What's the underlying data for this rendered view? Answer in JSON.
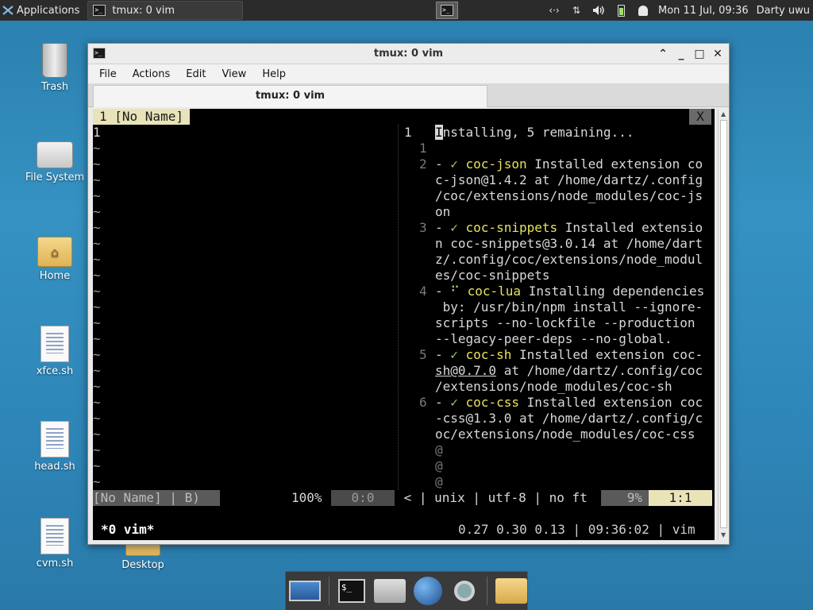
{
  "top_panel": {
    "applications_label": "Applications",
    "task_title": "tmux: 0 vim",
    "clock": "Mon 11 Jul, 09:36",
    "user": "Darty uwu",
    "icons": [
      "network-icon",
      "transfer-icon",
      "volume-icon",
      "battery-icon",
      "notification-bell-icon"
    ]
  },
  "desktop_icons": [
    {
      "label": "Trash",
      "icon": "trash-icon"
    },
    {
      "label": "File System",
      "icon": "drive-icon"
    },
    {
      "label": "Home",
      "icon": "home-folder-icon"
    },
    {
      "label": "xfce.sh",
      "icon": "script-file-icon"
    },
    {
      "label": "head.sh",
      "icon": "script-file-icon"
    },
    {
      "label": "cvm.sh",
      "icon": "script-file-icon"
    },
    {
      "label": "Desktop",
      "icon": "folder-icon"
    }
  ],
  "window": {
    "title": "tmux: 0 vim",
    "menu": [
      "File",
      "Actions",
      "Edit",
      "View",
      "Help"
    ],
    "tab_label": "tmux: 0 vim"
  },
  "terminal": {
    "buffer_tab": "1 [No Name]",
    "close_tab": "X",
    "left_line_number": "1",
    "tilde": "~",
    "right_lines": {
      "l1_num": "1",
      "l1_text_first": "I",
      "l1_text_rest": "nstalling, 5 remaining...",
      "n1": "1",
      "n2": "2",
      "n3": "3",
      "n4": "4",
      "n5": "5",
      "n6": "6",
      "dash": "- ",
      "check": "✓ ",
      "spinner": "⠋ ",
      "e1_name": "coc-json",
      "e1_a": " Installed extension co",
      "e1_b": "c-json@1.4.2 at /home/dartz/.config",
      "e1_c": "/coc/extensions/node_modules/coc-js",
      "e1_d": "on",
      "e2_name": "coc-snippets",
      "e2_a": " Installed extensio",
      "e2_b": "n coc-snippets@3.0.14 at /home/dart",
      "e2_c": "z/.config/coc/extensions/node_modul",
      "e2_d": "es/coc-snippets",
      "e3_name": "coc-lua",
      "e3_a": " Installing dependencies",
      "e3_b": " by: /usr/bin/npm install --ignore-",
      "e3_c": "scripts --no-lockfile --production",
      "e3_d": "--legacy-peer-deps --no-global.",
      "e4_name": "coc-sh",
      "e4_a": " Installed extension coc-",
      "e4_b_ul": "sh@0.7.0",
      "e4_b": " at /home/dartz/.config/coc",
      "e4_c": "/extensions/node_modules/coc-sh",
      "e5_name": "coc-css",
      "e5_a": " Installed extension coc",
      "e5_b": "-css@1.3.0 at /home/dartz/.config/c",
      "e5_c": "oc/extensions/node_modules/coc-css",
      "at": "@"
    },
    "status_line": {
      "left": "[No Name] | B)",
      "percent": "100%",
      "pos_left": "0:0",
      "right_info": " < | unix | utf-8 | no ft ",
      "pct_right": "9%",
      "pos_right": "1:1"
    },
    "tmux_bar": {
      "window": "*0 vim*",
      "right": "0.27 0.30 0.13 | 09:36:02 | vim"
    }
  },
  "dock": [
    "desktop-icon",
    "terminal-icon",
    "home-icon",
    "web-browser-icon",
    "search-icon",
    "file-manager-icon"
  ]
}
